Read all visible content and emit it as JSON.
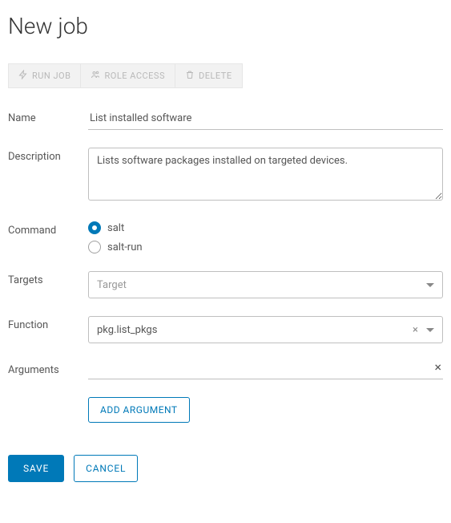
{
  "header": {
    "title": "New job"
  },
  "toolbar": {
    "runJob": "RUN JOB",
    "roleAccess": "ROLE ACCESS",
    "delete": "DELETE"
  },
  "form": {
    "labels": {
      "name": "Name",
      "description": "Description",
      "command": "Command",
      "targets": "Targets",
      "function": "Function",
      "arguments": "Arguments"
    },
    "values": {
      "name": "List installed software",
      "description": "Lists software packages installed on targeted devices.",
      "command": "salt",
      "targets": "",
      "function": "pkg.list_pkgs",
      "arguments": [
        ""
      ]
    },
    "options": {
      "command": [
        {
          "value": "salt",
          "label": "salt"
        },
        {
          "value": "salt-run",
          "label": "salt-run"
        }
      ],
      "targetsPlaceholder": "Target"
    },
    "addArgument": "ADD ARGUMENT"
  },
  "footer": {
    "save": "SAVE",
    "cancel": "CANCEL"
  }
}
